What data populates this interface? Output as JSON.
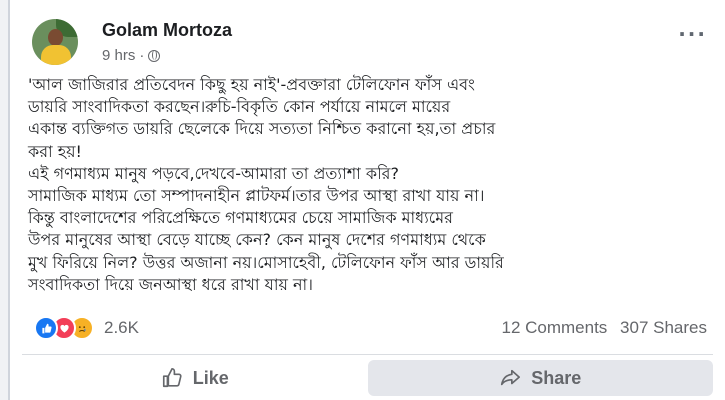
{
  "post": {
    "author": "Golam Mortoza",
    "time": "9 hrs",
    "separator": "·",
    "more": "···",
    "lines": [
      "'আল জাজিরার প্রতিবেদন কিছু হয় নাই'-প্রবক্তারা  টেলিফোন ফাঁস এবং",
      "ডায়রি সাংবাদিকতা করছেন।রুচি-বিকৃতি কোন পর্যায়ে নামলে মায়ের",
      "একান্ত ব্যক্তিগত ডায়রি ছেলেকে দিয়ে সত্যতা নিশ্চিত করানো হয়,তা প্রচার",
      "করা হয়!",
      "এই গণমাধ্যম মানুষ পড়বে,দেখবে-আমারা তা প্রত্যাশা করি?",
      "সামাজিক মাধ্যম তো সম্পাদনাহীন প্লাটফর্ম।তার উপর আস্থা রাখা যায় না।",
      "কিন্তু বাংলাদেশের পরিপ্রেক্ষিতে গণমাধ্যমের চেয়ে সামাজিক মাধ্যমের",
      "উপর মানুষের আস্থা বেড়ে যাচ্ছে কেন? কেন মানুষ দেশের গণমাধ্যম থেকে",
      "মুখ ফিরিয়ে নিল? উত্তর অজানা নয়।মোসাহেবী, টেলিফোন ফাঁস আর ডায়রি",
      "সংবাদিকতা দিয়ে জনআস্থা ধরে রাখা যায় না।"
    ]
  },
  "stats": {
    "reactions_count": "2.6K",
    "comments": "12 Comments",
    "shares": "307 Shares",
    "reaction_icons": [
      "like-icon",
      "love-icon",
      "sad-icon"
    ]
  },
  "actions": {
    "like": "Like",
    "share": "Share"
  },
  "colors": {
    "like": "#1877f2",
    "love": "#f33e58",
    "sad": "#f7b125",
    "secondary_text": "#65676b"
  }
}
